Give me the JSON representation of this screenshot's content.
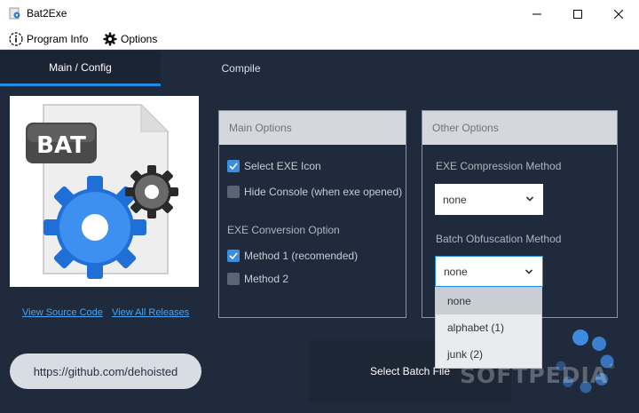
{
  "window": {
    "title": "Bat2Exe"
  },
  "menu": {
    "program_info": "Program Info",
    "options": "Options"
  },
  "tabs": [
    {
      "label": "Main / Config",
      "active": true
    },
    {
      "label": "Compile",
      "active": false
    }
  ],
  "logo": {
    "text": "BAT"
  },
  "links": {
    "view_source": "View Source Code",
    "view_releases": "View All Releases"
  },
  "github_button": "https://github.com/dehoisted",
  "main_options": {
    "header": "Main Options",
    "select_exe_icon": {
      "label": "Select EXE Icon",
      "checked": true
    },
    "hide_console": {
      "label": "Hide Console (when exe opened)",
      "checked": false
    },
    "conversion_label": "EXE Conversion Option",
    "method1": {
      "label": "Method 1 (recomended)",
      "checked": true
    },
    "method2": {
      "label": "Method 2",
      "checked": false
    }
  },
  "other_options": {
    "header": "Other Options",
    "compression_label": "EXE Compression Method",
    "compression_value": "none",
    "obfuscation_label": "Batch Obfuscation Method",
    "obfuscation_value": "none",
    "obfuscation_options": [
      "none",
      "alphabet (1)",
      "junk (2)"
    ]
  },
  "select_batch_button": "Select Batch File",
  "watermark": {
    "text": "SOFTPEDIA",
    "mark": "®"
  },
  "colors": {
    "accent": "#1f8be0",
    "background": "#1f2b3c",
    "checkbox_on": "#3b8ede",
    "link": "#4aa3f0"
  }
}
